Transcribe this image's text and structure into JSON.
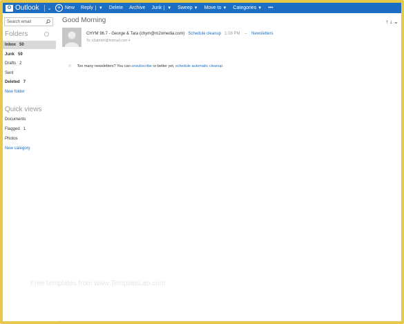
{
  "brand": {
    "name": "Outlook",
    "logo_letter": "O"
  },
  "commands": {
    "new": "New",
    "reply": "Reply",
    "delete": "Delete",
    "archive": "Archive",
    "junk": "Junk",
    "sweep": "Sweep",
    "move_to": "Move to",
    "categories": "Categories",
    "more": "•••"
  },
  "search": {
    "placeholder": "Search email"
  },
  "folders": {
    "title": "Folders",
    "items": [
      {
        "label": "Inbox",
        "count": "50"
      },
      {
        "label": "Junk",
        "count": "59"
      },
      {
        "label": "Drafts",
        "count": "2"
      },
      {
        "label": "Sent",
        "count": ""
      },
      {
        "label": "Deleted",
        "count": "7"
      }
    ],
    "new_folder": "New folder"
  },
  "quick_views": {
    "title": "Quick views",
    "items": [
      {
        "label": "Documents",
        "count": ""
      },
      {
        "label": "Flagged",
        "count": "1"
      },
      {
        "label": "Photos",
        "count": ""
      }
    ],
    "new_category": "New category"
  },
  "message": {
    "subject": "Good Morning",
    "sender_name": "CHYM 96.7 - George & Tara",
    "sender_email": "(chym@m2omedia.com)",
    "schedule_cleanup": "Schedule cleanup",
    "time": "1:08 PM",
    "category": "Newsletters",
    "to_line": "To: s3abram@hotmail.com"
  },
  "notice": {
    "text_before": "Too many newsletters? You can",
    "unsubscribe": "unsubscribe",
    "text_middle": "or better yet,",
    "schedule": "schedule automatic cleanup."
  },
  "watermark": "Free templates from www.TemplateLab.com",
  "colors": {
    "accent": "#1c6ec4",
    "frame": "#e6c84a",
    "selected": "#d9d9d9"
  }
}
